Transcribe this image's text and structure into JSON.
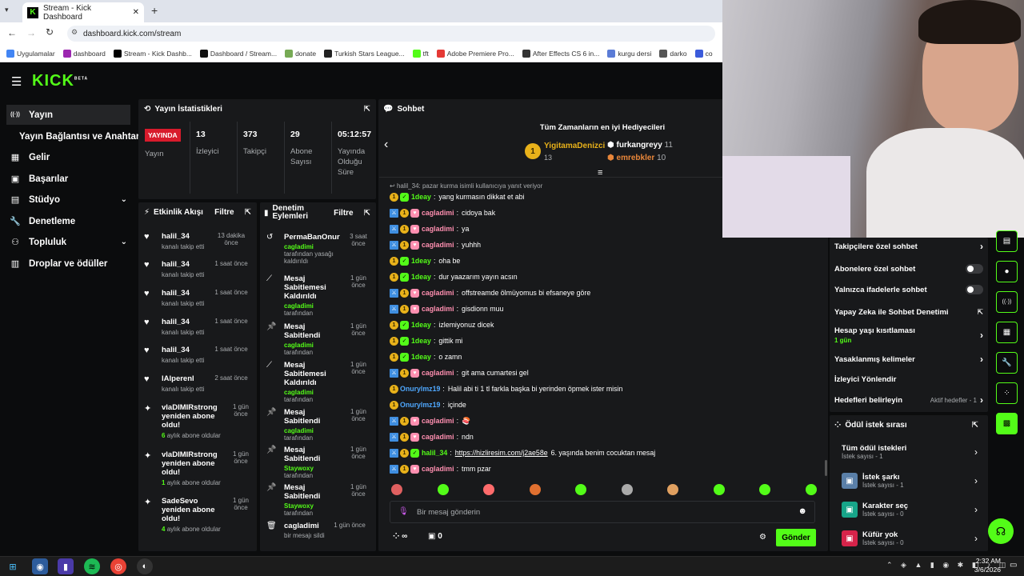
{
  "browser": {
    "tab_title": "Stream - Kick Dashboard",
    "url": "dashboard.kick.com/stream",
    "bookmarks": [
      "Uygulamalar",
      "dashboard",
      "Stream - Kick Dashb...",
      "Dashboard / Stream...",
      "donate",
      "Turkish Stars League...",
      "tft",
      "Adobe Premiere Pro...",
      "After Effects CS 6 in...",
      "kurgu dersi",
      "darko",
      "co"
    ]
  },
  "logo": "KICK",
  "logo_sup": "BETA",
  "sidebar": [
    {
      "label": "Yayın",
      "icon": "broadcast-icon"
    },
    {
      "label": "Yayın Bağlantısı ve Anahtarı",
      "icon": ""
    },
    {
      "label": "Gelir",
      "icon": "revenue-icon"
    },
    {
      "label": "Başarılar",
      "icon": "trophy-icon"
    },
    {
      "label": "Stüdyo",
      "icon": "studio-icon"
    },
    {
      "label": "Denetleme",
      "icon": "wrench-icon"
    },
    {
      "label": "Topluluk",
      "icon": "community-icon"
    },
    {
      "label": "Droplar ve ödüller",
      "icon": "gift-icon"
    }
  ],
  "stats": {
    "title": "Yayın İstatistikleri",
    "live_badge": "YAYINDA",
    "live_label": "Yayın",
    "items": [
      {
        "value": "13",
        "label": "İzleyici"
      },
      {
        "value": "373",
        "label": "Takipçi"
      },
      {
        "value": "29",
        "label": "Abone Sayısı"
      },
      {
        "value": "05:12:57",
        "label": "Yayında Olduğu Süre"
      }
    ]
  },
  "activity": {
    "title": "Etkinlik Akışı",
    "filter": "Filtre",
    "items": [
      {
        "name": "halil_34",
        "sub": "kanalı takip etti",
        "time": "13 dakika önce",
        "icon": "heart-icon"
      },
      {
        "name": "halil_34",
        "sub": "kanalı takip etti",
        "time": "1 saat önce",
        "icon": "heart-icon"
      },
      {
        "name": "halil_34",
        "sub": "kanalı takip etti",
        "time": "1 saat önce",
        "icon": "heart-icon"
      },
      {
        "name": "halil_34",
        "sub": "kanalı takip etti",
        "time": "1 saat önce",
        "icon": "heart-icon"
      },
      {
        "name": "halil_34",
        "sub": "kanalı takip etti",
        "time": "1 saat önce",
        "icon": "heart-icon"
      },
      {
        "name": "lAlperenl",
        "sub": "kanalı takip etti",
        "time": "2 saat önce",
        "icon": "heart-icon"
      },
      {
        "name": "vlaDIMIRstrong yeniden abone oldu!",
        "sub_num": "6",
        "sub": "aylık abone oldular",
        "time": "1 gün önce",
        "icon": "sparkle-icon"
      },
      {
        "name": "vlaDIMIRstrong yeniden abone oldu!",
        "sub_num": "1",
        "sub": "aylık abone oldular",
        "time": "1 gün önce",
        "icon": "sparkle-icon"
      },
      {
        "name": "SadeSevo yeniden abone oldu!",
        "sub_num": "4",
        "sub": "aylık abone oldular",
        "time": "1 gün önce",
        "icon": "sparkle-icon"
      }
    ]
  },
  "moderation": {
    "title": "Denetim Eylemleri",
    "filter": "Filtre",
    "items": [
      {
        "title": "PermaBanOnur",
        "actor": "cagladimi",
        "sub": "tarafından yasağı kaldırıldı",
        "time": "3 saat önce",
        "icon": "unban-icon"
      },
      {
        "title": "Mesaj Sabitlemesi Kaldırıldı",
        "actor": "cagladimi",
        "sub": "tarafından",
        "time": "1 gün önce",
        "icon": "unpin-icon"
      },
      {
        "title": "Mesaj Sabitlendi",
        "actor": "cagladimi",
        "sub": "tarafından",
        "time": "1 gün önce",
        "icon": "pin-icon"
      },
      {
        "title": "Mesaj Sabitlemesi Kaldırıldı",
        "actor": "cagladimi",
        "sub": "tarafından",
        "time": "1 gün önce",
        "icon": "unpin-icon"
      },
      {
        "title": "Mesaj Sabitlendi",
        "actor": "cagladimi",
        "sub": "tarafından",
        "time": "1 gün önce",
        "icon": "pin-icon"
      },
      {
        "title": "Mesaj Sabitlendi",
        "actor": "Staywoxy",
        "sub": "tarafından",
        "time": "1 gün önce",
        "icon": "pin-icon"
      },
      {
        "title": "Mesaj Sabitlendi",
        "actor": "Staywoxy",
        "sub": "tarafından",
        "time": "1 gün önce",
        "icon": "pin-icon"
      },
      {
        "title": "cagladimi",
        "actor": "",
        "sub": "bir mesajı sildi",
        "time": "1 gün önce",
        "icon": "trash-icon"
      }
    ]
  },
  "chat": {
    "title": "Sohbet",
    "gifters_title": "Tüm Zamanların en iyi Hediyecileri",
    "gifters": [
      {
        "name": "YigitamaDenizci",
        "count": "13"
      },
      {
        "name": "furkangreyy",
        "count": "11"
      },
      {
        "name": "emrebkler",
        "count": "10"
      }
    ],
    "reply_hint": "halil_34: pazar kurma isimli kullanıcıya yanıt veriyor",
    "messages": [
      {
        "user": "1deay",
        "text": "yang kurmasın dikkat et abi",
        "color": "#53fc18",
        "b": [
          "1",
          "g"
        ]
      },
      {
        "user": "cagladimi",
        "text": "cidoya bak",
        "color": "#ff8fb0",
        "b": [
          "b",
          "1",
          "p"
        ]
      },
      {
        "user": "cagladimi",
        "text": "ya",
        "color": "#ff8fb0",
        "b": [
          "b",
          "1",
          "p"
        ]
      },
      {
        "user": "cagladimi",
        "text": "yuhhh",
        "color": "#ff8fb0",
        "b": [
          "b",
          "1",
          "p"
        ]
      },
      {
        "user": "1deay",
        "text": "oha be",
        "color": "#53fc18",
        "b": [
          "1",
          "g"
        ]
      },
      {
        "user": "1deay",
        "text": "dur yaazarım yayın acsın",
        "color": "#53fc18",
        "b": [
          "1",
          "g"
        ]
      },
      {
        "user": "cagladimi",
        "text": "offstreamde ölmüyomus bi efsaneye göre",
        "color": "#ff8fb0",
        "b": [
          "b",
          "1",
          "p"
        ]
      },
      {
        "user": "cagladimi",
        "text": "gisdionn muu",
        "color": "#ff8fb0",
        "b": [
          "b",
          "1",
          "p"
        ]
      },
      {
        "user": "1deay",
        "text": "izlemiyonuz dicek",
        "color": "#53fc18",
        "b": [
          "1",
          "g"
        ]
      },
      {
        "user": "1deay",
        "text": "gittik mi",
        "color": "#53fc18",
        "b": [
          "1",
          "g"
        ]
      },
      {
        "user": "1deay",
        "text": "o zamn",
        "color": "#53fc18",
        "b": [
          "1",
          "g"
        ]
      },
      {
        "user": "cagladimi",
        "text": "git ama cumartesi gel",
        "color": "#ff8fb0",
        "b": [
          "b",
          "1",
          "p"
        ]
      },
      {
        "user": "Onurylmz19",
        "text": "Halil abi ti 1 tl farkla başka bi yerinden öpmek ister misin",
        "color": "#4fa8ff",
        "b": [
          "1"
        ]
      },
      {
        "user": "Onurylmz19",
        "text": "içinde",
        "color": "#4fa8ff",
        "b": [
          "1"
        ]
      },
      {
        "user": "cagladimi",
        "text": "🍣",
        "color": "#ff8fb0",
        "b": [
          "b",
          "1",
          "p"
        ]
      },
      {
        "user": "cagladimi",
        "text": "ndn",
        "color": "#ff8fb0",
        "b": [
          "b",
          "1",
          "p"
        ]
      },
      {
        "user": "halil_34",
        "text": "6. yaşında benim cocuktan mesaj",
        "link": "https://hizliresim.com/j2ae58e",
        "color": "#53fc18",
        "b": [
          "b",
          "1",
          "g"
        ]
      },
      {
        "user": "cagladimi",
        "text": "tmm pzar",
        "color": "#ff8fb0",
        "b": [
          "b",
          "1",
          "p"
        ]
      }
    ],
    "input_placeholder": "Bir mesaj gönderin",
    "points": "∞",
    "gift_count": "0",
    "send": "Gönder"
  },
  "settings": [
    {
      "label": "Takipçilere özel sohbet",
      "type": "chevron"
    },
    {
      "label": "Abonelere özel sohbet",
      "type": "toggle"
    },
    {
      "label": "Yalnızca ifadelerle sohbet",
      "type": "toggle"
    },
    {
      "label": "Yapay Zeka ile Sohbet Denetimi",
      "type": "external"
    },
    {
      "label": "Hesap yaşı kısıtlaması",
      "sub": "1 gün",
      "type": "chevron"
    },
    {
      "label": "Yasaklanmış kelimeler",
      "type": "chevron"
    },
    {
      "label": "İzleyici Yönlendir",
      "type": "none"
    },
    {
      "label": "Hedefleri belirleyin",
      "sub_right": "Aktif hedefler - 1",
      "type": "chevron"
    }
  ],
  "rewards": {
    "title": "Ödül istek sırası",
    "items": [
      {
        "title": "Tüm ödül istekleri",
        "sub": "İstek sayısı - 1",
        "color": ""
      },
      {
        "title": "İstek şarkı",
        "sub": "İstek sayısı - 1",
        "color": "#5a7fa8"
      },
      {
        "title": "Karakter seç",
        "sub": "İstek sayısı - 0",
        "color": "#17a589"
      },
      {
        "title": "Küfür yok",
        "sub": "İstek sayısı - 0",
        "color": "#d6234a"
      }
    ]
  },
  "taskbar": {
    "time": "2:32 AM",
    "date": "3/6/2026"
  }
}
